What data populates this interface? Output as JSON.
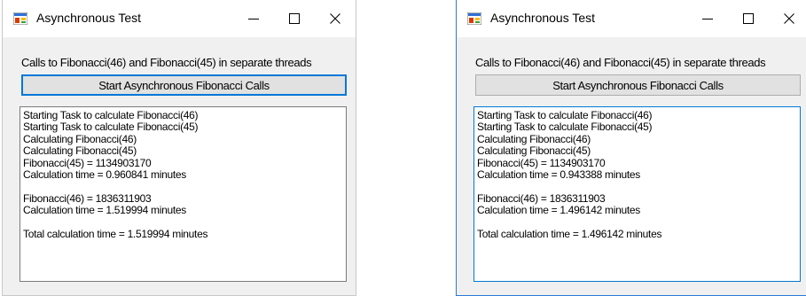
{
  "windows": [
    {
      "title": "Asynchronous Test",
      "description": "Calls to Fibonacci(46) and Fibonacci(45) in separate threads",
      "button_label": "Start Asynchronous Fibonacci Calls",
      "output_lines": [
        "Starting Task to calculate Fibonacci(46)",
        "Starting Task to calculate Fibonacci(45)",
        "Calculating Fibonacci(46)",
        "Calculating Fibonacci(45)",
        "Fibonacci(45) = 1134903170",
        "Calculation time = 0.960841 minutes",
        "",
        "Fibonacci(46) = 1836311903",
        "Calculation time = 1.519994 minutes",
        "",
        "Total calculation time = 1.519994 minutes"
      ]
    },
    {
      "title": "Asynchronous Test",
      "description": "Calls to Fibonacci(46) and Fibonacci(45) in separate threads",
      "button_label": "Start Asynchronous Fibonacci Calls",
      "output_lines": [
        "Starting Task to calculate Fibonacci(46)",
        "Starting Task to calculate Fibonacci(45)",
        "Calculating Fibonacci(46)",
        "Calculating Fibonacci(45)",
        "Fibonacci(45) = 1134903170",
        "Calculation time = 0.943388 minutes",
        "",
        "Fibonacci(46) = 1836311903",
        "Calculation time = 1.496142 minutes",
        "",
        "Total calculation time = 1.496142 minutes"
      ]
    }
  ],
  "icons": {
    "app": "app-window-icon",
    "minimize": "minimize-icon",
    "maximize": "maximize-icon",
    "close": "close-icon"
  },
  "colors": {
    "focus_blue": "#0078d7",
    "window_bg": "#f0f0f0"
  }
}
